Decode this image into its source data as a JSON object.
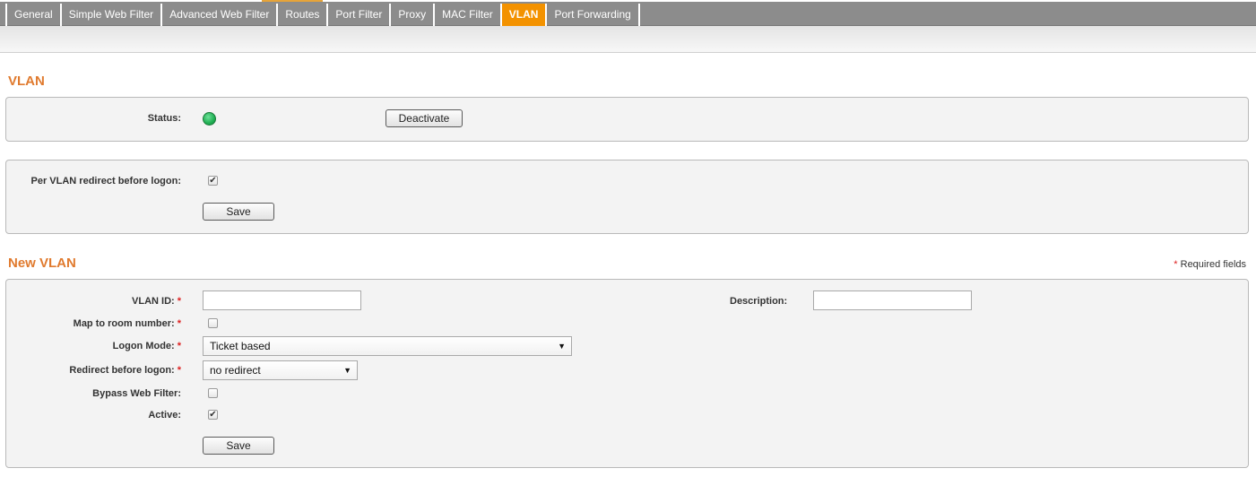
{
  "tabs": [
    {
      "label": "General",
      "active": false
    },
    {
      "label": "Simple Web Filter",
      "active": false
    },
    {
      "label": "Advanced Web Filter",
      "active": false
    },
    {
      "label": "Routes",
      "active": false
    },
    {
      "label": "Port Filter",
      "active": false
    },
    {
      "label": "Proxy",
      "active": false
    },
    {
      "label": "MAC Filter",
      "active": false
    },
    {
      "label": "VLAN",
      "active": true
    },
    {
      "label": "Port Forwarding",
      "active": false
    }
  ],
  "vlan_section": {
    "title": "VLAN",
    "status_label": "Status:",
    "status_state": "active",
    "status_color": "#1fae52",
    "deactivate_label": "Deactivate"
  },
  "redirect_section": {
    "per_vlan_label": "Per VLAN redirect before logon:",
    "per_vlan_checked": true,
    "save_label": "Save"
  },
  "new_vlan": {
    "title": "New VLAN",
    "required_note": "Required fields",
    "required_marker": "*",
    "vlan_id_label": "VLAN ID:",
    "vlan_id_value": "",
    "description_label": "Description:",
    "description_value": "",
    "map_room_label": "Map to room number:",
    "map_room_checked": false,
    "logon_mode_label": "Logon Mode:",
    "logon_mode_value": "Ticket based",
    "redirect_label": "Redirect before logon:",
    "redirect_value": "no redirect",
    "bypass_label": "Bypass Web Filter:",
    "bypass_checked": false,
    "active_label": "Active:",
    "active_checked": true,
    "save_label": "Save"
  },
  "colors": {
    "accent": "#f39200",
    "section_title": "#e07a2e",
    "tabbar": "#8c8c8c"
  }
}
